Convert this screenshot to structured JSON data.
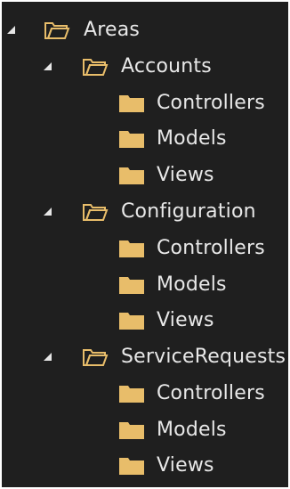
{
  "tree": {
    "colors": {
      "background": "#1f1f1f",
      "text": "#e8e8e8",
      "folder_fill": "#e8bd6a",
      "folder_stroke": "#d6a74d"
    },
    "areas": {
      "label": "Areas",
      "icon": "folder-open-icon",
      "expanded": true,
      "children": [
        {
          "label": "Accounts",
          "icon": "folder-open-icon",
          "expanded": true,
          "children": [
            {
              "label": "Controllers",
              "icon": "folder-icon"
            },
            {
              "label": "Models",
              "icon": "folder-icon"
            },
            {
              "label": "Views",
              "icon": "folder-icon"
            }
          ]
        },
        {
          "label": "Configuration",
          "icon": "folder-open-icon",
          "expanded": true,
          "children": [
            {
              "label": "Controllers",
              "icon": "folder-icon"
            },
            {
              "label": "Models",
              "icon": "folder-icon"
            },
            {
              "label": "Views",
              "icon": "folder-icon"
            }
          ]
        },
        {
          "label": "ServiceRequests",
          "icon": "folder-open-icon",
          "expanded": true,
          "children": [
            {
              "label": "Controllers",
              "icon": "folder-icon"
            },
            {
              "label": "Models",
              "icon": "folder-icon"
            },
            {
              "label": "Views",
              "icon": "folder-icon"
            }
          ]
        }
      ]
    }
  }
}
